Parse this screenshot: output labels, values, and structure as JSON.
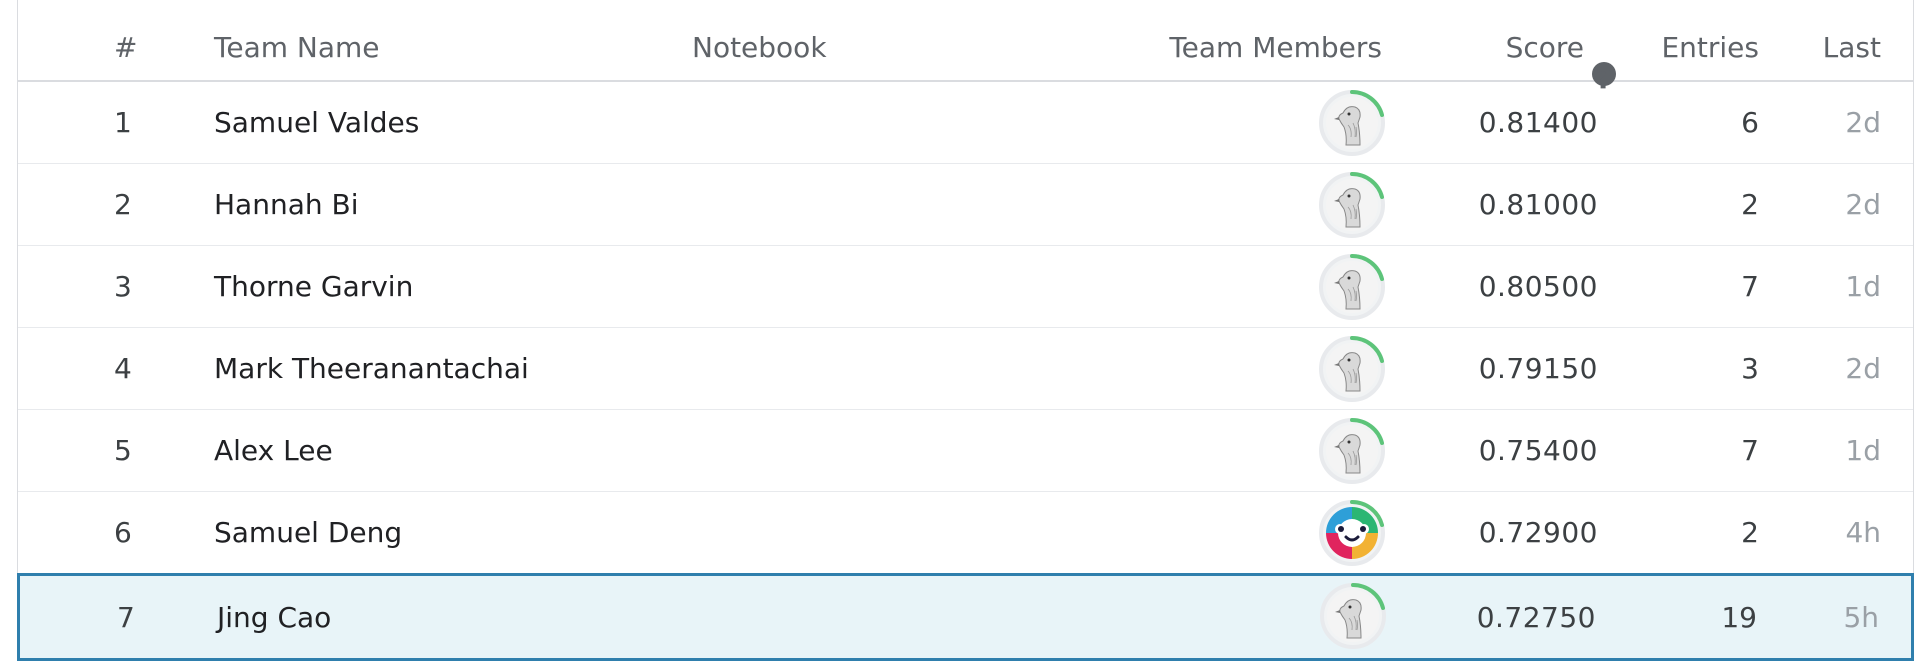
{
  "header": {
    "rank": "#",
    "team_name": "Team Name",
    "notebook": "Notebook",
    "team_members": "Team Members",
    "score": "Score",
    "entries": "Entries",
    "last": "Last",
    "score_help_icon": "question-circle-icon"
  },
  "rows": [
    {
      "rank": "1",
      "name": "Samuel Valdes",
      "avatar": "goose-avatar",
      "score": "0.81400",
      "entries": "6",
      "last": "2d"
    },
    {
      "rank": "2",
      "name": "Hannah Bi",
      "avatar": "goose-avatar",
      "score": "0.81000",
      "entries": "2",
      "last": "2d"
    },
    {
      "rank": "3",
      "name": "Thorne Garvin",
      "avatar": "goose-avatar",
      "score": "0.80500",
      "entries": "7",
      "last": "1d"
    },
    {
      "rank": "4",
      "name": "Mark Theeranantachai",
      "avatar": "goose-avatar",
      "score": "0.79150",
      "entries": "3",
      "last": "2d"
    },
    {
      "rank": "5",
      "name": "Alex Lee",
      "avatar": "goose-avatar",
      "score": "0.75400",
      "entries": "7",
      "last": "1d"
    },
    {
      "rank": "6",
      "name": "Samuel Deng",
      "avatar": "colorful-face-avatar",
      "score": "0.72900",
      "entries": "2",
      "last": "4h"
    },
    {
      "rank": "7",
      "name": "Jing Cao",
      "avatar": "goose-avatar",
      "score": "0.72750",
      "entries": "19",
      "last": "5h",
      "highlighted": true
    }
  ],
  "colors": {
    "progress_ring": "#5dc47a",
    "highlight_bg": "#e8f4f8",
    "highlight_border": "#2f7fad"
  }
}
